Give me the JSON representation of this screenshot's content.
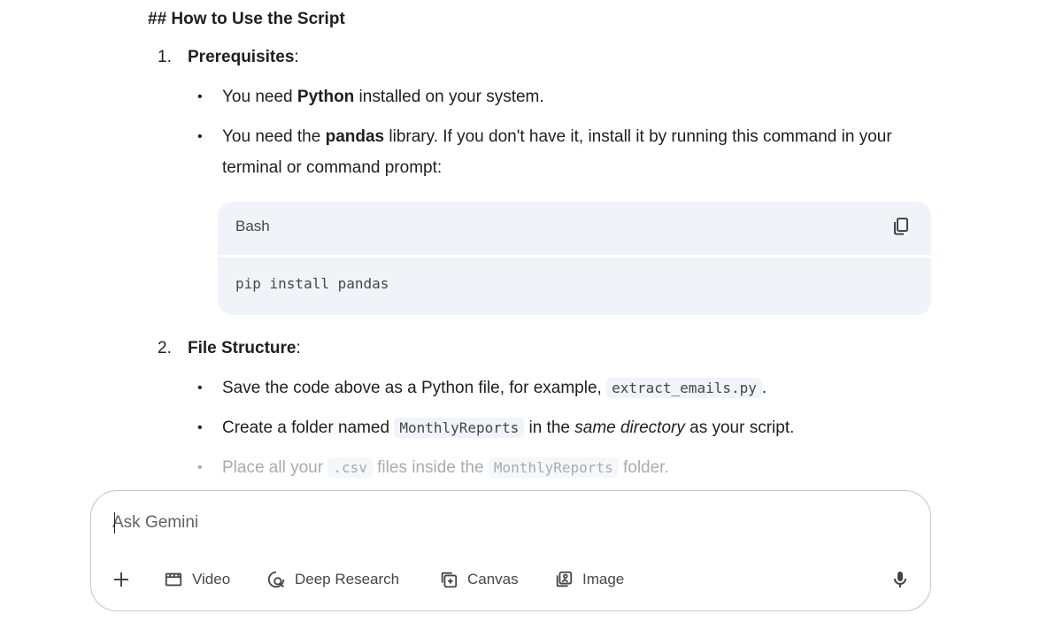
{
  "content": {
    "heading": "## How to Use the Script",
    "steps": [
      {
        "number": "1.",
        "title": "Prerequisites",
        "suffix": ":",
        "bullets": [
          {
            "pre": "You need ",
            "bold": "Python",
            "post": " installed on your system."
          },
          {
            "pre": "You need the ",
            "bold": "pandas",
            "post": " library. If you don't have it, install it by running this command in your terminal or command prompt:"
          }
        ],
        "codeblock": {
          "language": "Bash",
          "code": "pip install pandas",
          "copy_icon": "copy-icon"
        }
      },
      {
        "number": "2.",
        "title": "File Structure",
        "suffix": ":",
        "bullets": [
          {
            "pre": "Save the code above as a Python file, for example, ",
            "code": "extract_emails.py",
            "post": "."
          },
          {
            "pre": "Create a folder named ",
            "code": "MonthlyReports",
            "mid": " in the ",
            "italic": "same directory",
            "post": " as your script."
          },
          {
            "pre": "Place all your ",
            "code": ".csv",
            "mid": " files inside the ",
            "code2": "MonthlyReports",
            "post": " folder."
          }
        ]
      }
    ]
  },
  "input": {
    "placeholder": "Ask Gemini",
    "tools": [
      {
        "label": "Video",
        "icon": "video-icon"
      },
      {
        "label": "Deep Research",
        "icon": "deep-research-icon"
      },
      {
        "label": "Canvas",
        "icon": "canvas-icon"
      },
      {
        "label": "Image",
        "icon": "image-icon"
      }
    ],
    "plus_icon": "plus-icon",
    "mic_icon": "mic-icon"
  },
  "colors": {
    "text": "#1f1f1f",
    "muted": "#444746",
    "faded": "#a8abb0",
    "code_bg": "#f0f4f9",
    "border": "#c4c7c5"
  }
}
